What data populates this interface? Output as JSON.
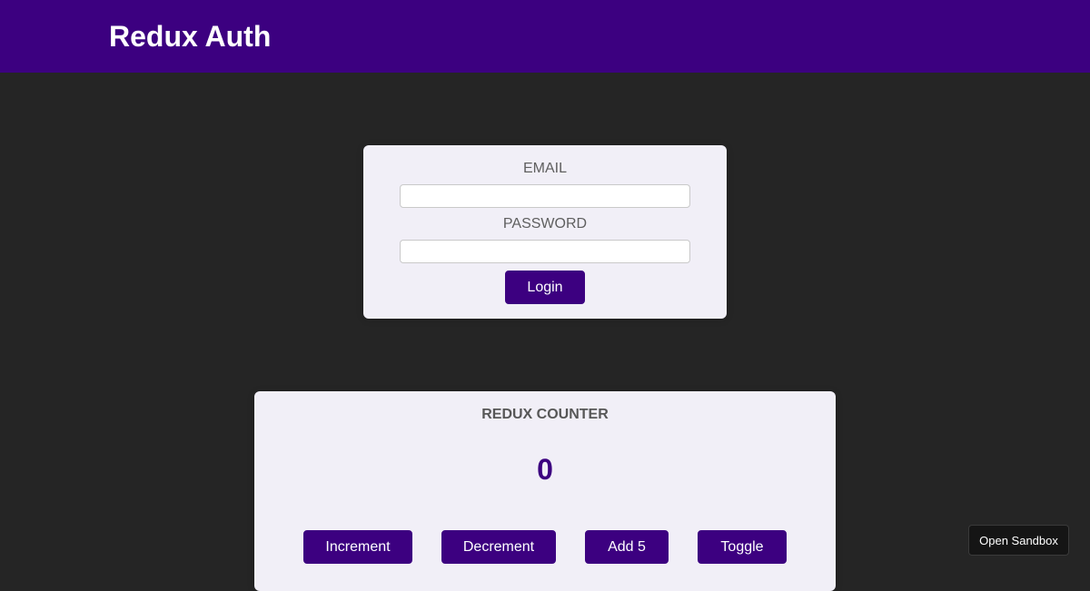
{
  "header": {
    "title": "Redux Auth"
  },
  "auth": {
    "email_label": "EMAIL",
    "email_value": "",
    "password_label": "PASSWORD",
    "password_value": "",
    "login_label": "Login"
  },
  "counter": {
    "title": "REDUX COUNTER",
    "value": "0",
    "buttons": {
      "increment": "Increment",
      "decrement": "Decrement",
      "add5": "Add 5",
      "toggle": "Toggle"
    }
  },
  "sandbox": {
    "label": "Open Sandbox"
  },
  "colors": {
    "header_bg": "#3c0080",
    "page_bg": "#252525",
    "card_bg": "#f1eff7",
    "accent": "#3c0080"
  }
}
